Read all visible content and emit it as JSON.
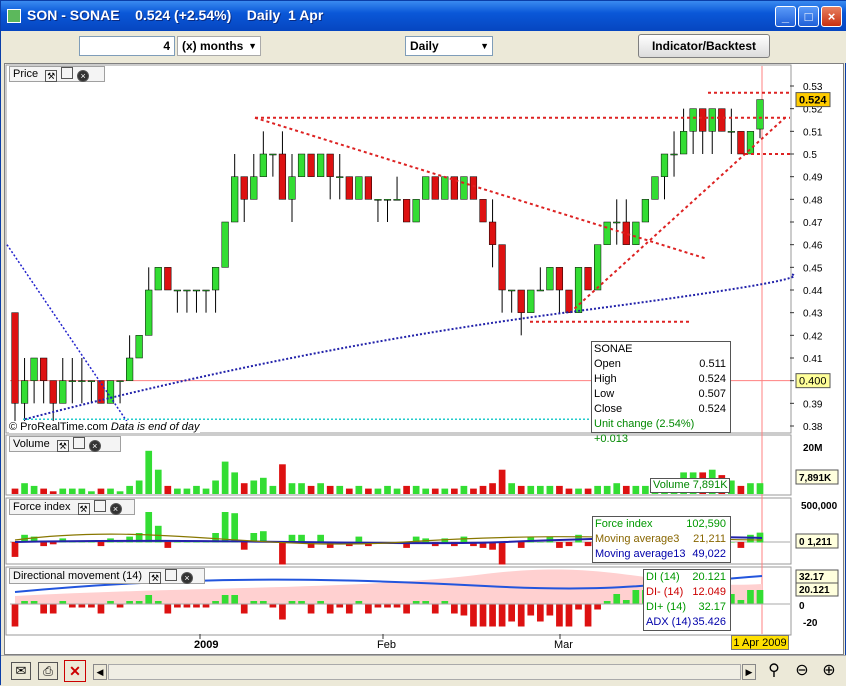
{
  "window": {
    "title": "SON - SONAE    0.524 (+2.54%)    Daily  1 Apr",
    "minimize_glyph": "_",
    "maximize_glyph": "□",
    "close_glyph": "×"
  },
  "toolbar": {
    "period_value": "4",
    "period_unit": "(x) months",
    "interval": "Daily",
    "indicator_button": "Indicator/Backtest"
  },
  "panels": {
    "price": {
      "label": "Price"
    },
    "volume": {
      "label": "Volume"
    },
    "force": {
      "label": "Force index"
    },
    "dm": {
      "label": "Directional movement (14)"
    }
  },
  "price_axis": {
    "ticks": [
      "0.53",
      "0.52",
      "0.51",
      "0.5",
      "0.49",
      "0.48",
      "0.47",
      "0.46",
      "0.45",
      "0.44",
      "0.43",
      "0.42",
      "0.41",
      "0.4",
      "0.39",
      "0.38"
    ],
    "last_price": "0.524",
    "ref_price": "0.400"
  },
  "volume_axis": {
    "top": "20M",
    "badge": "7,891K"
  },
  "force_axis": {
    "top": "500,000",
    "badge": "0",
    "badge2": "1,211"
  },
  "dm_axis": {
    "badge1": "32.17",
    "badge2": "20.121",
    "badge3": "0",
    "bottom": "-20"
  },
  "date_axis": {
    "labels": [
      "2009",
      "Feb",
      "Mar"
    ],
    "cursor_date": "1 Apr 2009"
  },
  "watermark": {
    "source": "© ProRealTime.com",
    "note": "Data is end of day"
  },
  "ohlc_box": {
    "symbol": "SONAE",
    "rows": [
      {
        "label": "Open",
        "value": "0.511"
      },
      {
        "label": "High",
        "value": "0.524"
      },
      {
        "label": "Low",
        "value": "0.507"
      },
      {
        "label": "Close",
        "value": "0.524"
      }
    ],
    "unit_change": "Unit change (2.54%) +0.013"
  },
  "volume_box": {
    "text": "Volume 7,891K"
  },
  "force_box": {
    "rows": [
      {
        "label": "Force index",
        "value": "102,590"
      },
      {
        "label": "Moving average3",
        "value": "21,211"
      },
      {
        "label": "Moving average13",
        "value": "49,022"
      }
    ]
  },
  "dm_box": {
    "rows": [
      {
        "label": "DI (14)",
        "value": "20.121"
      },
      {
        "label": "DI- (14)",
        "value": "12.049"
      },
      {
        "label": "DI+ (14)",
        "value": "32.17"
      },
      {
        "label": "ADX (14)",
        "value": "35.426"
      }
    ]
  },
  "colors": {
    "up": "#33dd33",
    "down": "#dd1111",
    "trend": "#dd2222",
    "ma": "#2222aa",
    "ref": "#ff8080"
  },
  "chart_data": {
    "type": "candlestick",
    "symbol": "SONAE",
    "interval": "Daily",
    "ylim": [
      0.38,
      0.53
    ],
    "candles": [
      [
        0.43,
        0.43,
        0.38,
        0.39
      ],
      [
        0.39,
        0.41,
        0.38,
        0.4
      ],
      [
        0.4,
        0.41,
        0.39,
        0.41
      ],
      [
        0.41,
        0.41,
        0.39,
        0.4
      ],
      [
        0.4,
        0.4,
        0.38,
        0.39
      ],
      [
        0.39,
        0.41,
        0.39,
        0.4
      ],
      [
        0.4,
        0.41,
        0.39,
        0.4
      ],
      [
        0.4,
        0.41,
        0.39,
        0.4
      ],
      [
        0.4,
        0.4,
        0.39,
        0.4
      ],
      [
        0.4,
        0.4,
        0.39,
        0.39
      ],
      [
        0.39,
        0.4,
        0.39,
        0.4
      ],
      [
        0.4,
        0.4,
        0.39,
        0.4
      ],
      [
        0.4,
        0.42,
        0.4,
        0.41
      ],
      [
        0.41,
        0.42,
        0.41,
        0.42
      ],
      [
        0.42,
        0.45,
        0.42,
        0.44
      ],
      [
        0.44,
        0.45,
        0.44,
        0.45
      ],
      [
        0.45,
        0.45,
        0.44,
        0.44
      ],
      [
        0.44,
        0.44,
        0.43,
        0.44
      ],
      [
        0.44,
        0.44,
        0.43,
        0.44
      ],
      [
        0.44,
        0.44,
        0.43,
        0.44
      ],
      [
        0.44,
        0.44,
        0.43,
        0.44
      ],
      [
        0.44,
        0.45,
        0.43,
        0.45
      ],
      [
        0.45,
        0.47,
        0.45,
        0.47
      ],
      [
        0.47,
        0.5,
        0.47,
        0.49
      ],
      [
        0.49,
        0.49,
        0.47,
        0.48
      ],
      [
        0.48,
        0.5,
        0.48,
        0.49
      ],
      [
        0.49,
        0.51,
        0.49,
        0.5
      ],
      [
        0.5,
        0.5,
        0.49,
        0.5
      ],
      [
        0.5,
        0.51,
        0.48,
        0.48
      ],
      [
        0.48,
        0.5,
        0.47,
        0.49
      ],
      [
        0.49,
        0.5,
        0.49,
        0.5
      ],
      [
        0.5,
        0.5,
        0.49,
        0.49
      ],
      [
        0.49,
        0.5,
        0.49,
        0.5
      ],
      [
        0.5,
        0.5,
        0.48,
        0.49
      ],
      [
        0.49,
        0.5,
        0.48,
        0.49
      ],
      [
        0.49,
        0.49,
        0.48,
        0.48
      ],
      [
        0.48,
        0.49,
        0.48,
        0.49
      ],
      [
        0.49,
        0.49,
        0.48,
        0.48
      ],
      [
        0.48,
        0.48,
        0.47,
        0.48
      ],
      [
        0.48,
        0.48,
        0.47,
        0.48
      ],
      [
        0.48,
        0.49,
        0.48,
        0.48
      ],
      [
        0.48,
        0.48,
        0.47,
        0.47
      ],
      [
        0.47,
        0.48,
        0.47,
        0.48
      ],
      [
        0.48,
        0.49,
        0.48,
        0.49
      ],
      [
        0.49,
        0.49,
        0.48,
        0.48
      ],
      [
        0.48,
        0.49,
        0.48,
        0.49
      ],
      [
        0.49,
        0.49,
        0.48,
        0.48
      ],
      [
        0.48,
        0.49,
        0.48,
        0.49
      ],
      [
        0.49,
        0.49,
        0.48,
        0.48
      ],
      [
        0.48,
        0.48,
        0.47,
        0.47
      ],
      [
        0.47,
        0.48,
        0.45,
        0.46
      ],
      [
        0.46,
        0.46,
        0.43,
        0.44
      ],
      [
        0.44,
        0.44,
        0.43,
        0.44
      ],
      [
        0.44,
        0.44,
        0.42,
        0.43
      ],
      [
        0.43,
        0.44,
        0.43,
        0.44
      ],
      [
        0.44,
        0.45,
        0.44,
        0.44
      ],
      [
        0.44,
        0.45,
        0.44,
        0.45
      ],
      [
        0.45,
        0.45,
        0.43,
        0.44
      ],
      [
        0.44,
        0.44,
        0.43,
        0.43
      ],
      [
        0.43,
        0.45,
        0.43,
        0.45
      ],
      [
        0.45,
        0.45,
        0.44,
        0.44
      ],
      [
        0.44,
        0.46,
        0.44,
        0.46
      ],
      [
        0.46,
        0.47,
        0.46,
        0.47
      ],
      [
        0.47,
        0.48,
        0.46,
        0.47
      ],
      [
        0.47,
        0.48,
        0.46,
        0.46
      ],
      [
        0.46,
        0.47,
        0.46,
        0.47
      ],
      [
        0.47,
        0.48,
        0.47,
        0.48
      ],
      [
        0.48,
        0.49,
        0.48,
        0.49
      ],
      [
        0.49,
        0.5,
        0.48,
        0.5
      ],
      [
        0.5,
        0.51,
        0.49,
        0.5
      ],
      [
        0.5,
        0.52,
        0.5,
        0.51
      ],
      [
        0.51,
        0.52,
        0.5,
        0.52
      ],
      [
        0.52,
        0.52,
        0.5,
        0.51
      ],
      [
        0.51,
        0.52,
        0.5,
        0.52
      ],
      [
        0.52,
        0.52,
        0.51,
        0.51
      ],
      [
        0.51,
        0.52,
        0.5,
        0.51
      ],
      [
        0.51,
        0.51,
        0.5,
        0.5
      ],
      [
        0.5,
        0.51,
        0.5,
        0.51
      ],
      [
        0.511,
        0.524,
        0.507,
        0.524
      ]
    ],
    "volume": [
      2,
      4,
      3,
      2,
      1,
      2,
      2,
      2,
      1,
      2,
      2,
      1,
      3,
      5,
      16,
      9,
      3,
      2,
      2,
      3,
      2,
      5,
      12,
      8,
      4,
      5,
      6,
      3,
      11,
      4,
      4,
      3,
      4,
      3,
      3,
      2,
      3,
      2,
      2,
      3,
      2,
      3,
      3,
      2,
      2,
      2,
      2,
      3,
      2,
      3,
      4,
      9,
      4,
      3,
      3,
      3,
      3,
      3,
      2,
      2,
      2,
      3,
      3,
      4,
      3,
      3,
      3,
      4,
      5,
      5,
      8,
      8,
      8,
      9,
      7,
      5,
      3,
      4,
      4
    ],
    "vol_max": 20
  }
}
